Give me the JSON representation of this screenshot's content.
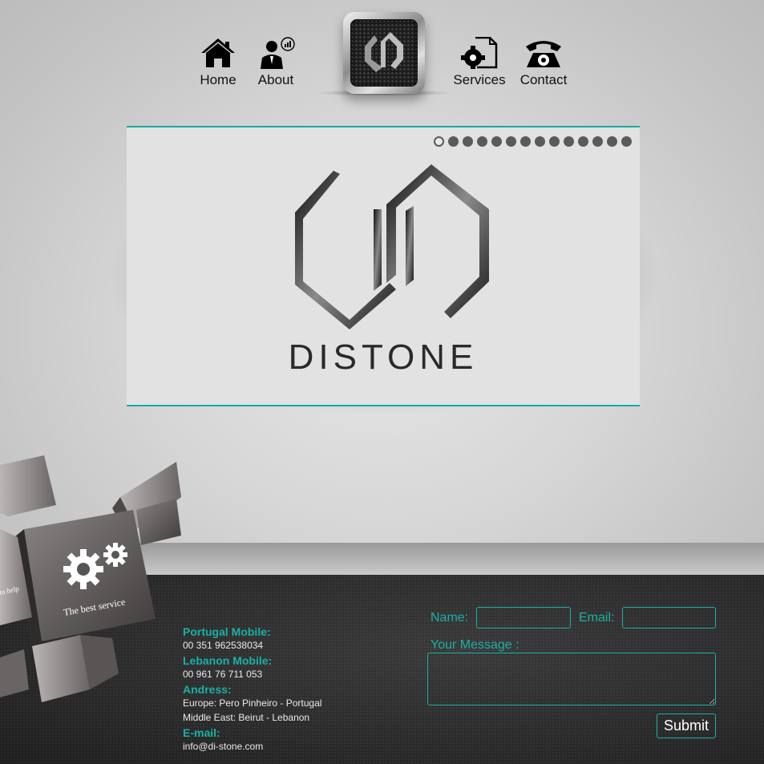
{
  "nav": {
    "items": [
      {
        "label": "Home",
        "icon": "house-icon"
      },
      {
        "label": "About",
        "icon": "person-chart-icon"
      },
      {
        "label": "Services",
        "icon": "gear-document-icon"
      },
      {
        "label": "Contact",
        "icon": "telephone-icon"
      }
    ],
    "logo_icon": "distone-emblem-icon"
  },
  "slider": {
    "brand": "DISTONE",
    "dot_count": 14,
    "active_dot": 1
  },
  "decor": {
    "cube_text": "The best service",
    "cube_text_partial": "to help"
  },
  "contact": {
    "portugal_mobile_label": "Portugal Mobile:",
    "portugal_mobile": "00 351 962538034",
    "lebanon_mobile_label": "Lebanon Mobile:",
    "lebanon_mobile": "00 961 76 711 053",
    "address_label": "Andress:",
    "address_europe": "Europe: Pero Pinheiro - Portugal",
    "address_middle_east": "Middle East: Beirut - Lebanon",
    "email_label": "E-mail:",
    "email": "info@di-stone.com"
  },
  "form": {
    "name_label": "Name:",
    "name_value": "",
    "email_label": "Email:",
    "email_value": "",
    "message_label": "Your Message :",
    "message_value": "",
    "submit_label": "Submit"
  },
  "colors": {
    "accent": "#1ab0a6",
    "slider_bg": "#e2e2e2",
    "footer_bg": "#2a2a2a"
  }
}
